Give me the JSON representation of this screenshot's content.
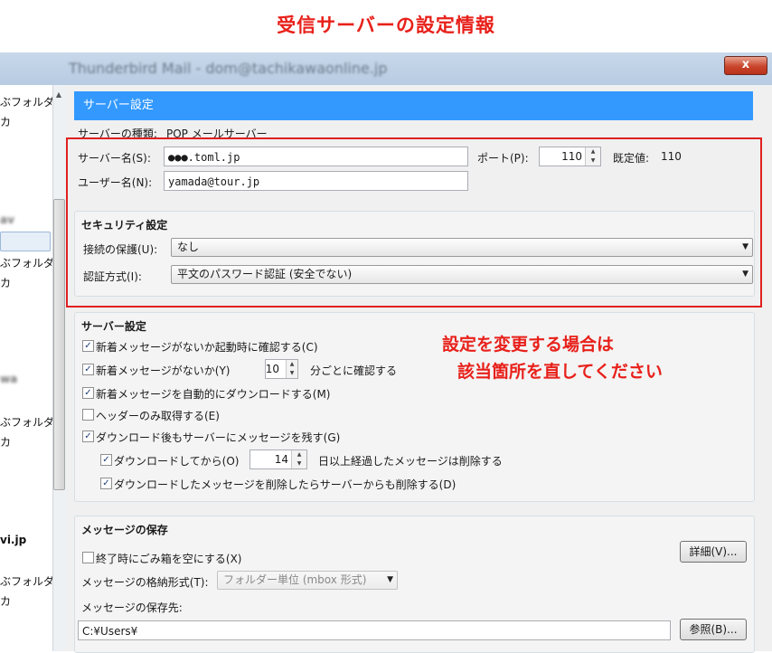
{
  "annotation": {
    "top_title": "受信サーバーの設定情報",
    "note_line1": "設定を変更する場合は",
    "note_line2": "該当箇所を直してください"
  },
  "window": {
    "title": "Thunderbird Mail - dom@tachikawaonline.jp",
    "close_label": "x"
  },
  "sidebar": {
    "items": [
      {
        "label": "ぶフォルダー"
      },
      {
        "label": "カ"
      },
      {
        "label": "ぶフォルダー"
      },
      {
        "label": "カ"
      },
      {
        "label": "ぶフォルダー"
      },
      {
        "label": "カ"
      },
      {
        "label": "vi.jp"
      },
      {
        "label": "ぶフォルダー"
      },
      {
        "label": "カ"
      }
    ]
  },
  "server_settings": {
    "banner": "サーバー設定",
    "server_type_label": "サーバーの種類:",
    "server_type_value": "POP メールサーバー",
    "server_name_label": "サーバー名(S):",
    "server_name_value": "●●●.toml.jp",
    "port_label": "ポート(P):",
    "port_value": "110",
    "default_label": "既定値:",
    "default_value": "110",
    "username_label": "ユーザー名(N):",
    "username_value": "yamada@tour.jp"
  },
  "security": {
    "title": "セキュリティ設定",
    "connection_label": "接続の保護(U):",
    "connection_value": "なし",
    "auth_label": "認証方式(I):",
    "auth_value": "平文のパスワード認証 (安全でない)"
  },
  "server_options": {
    "title": "サーバー設定",
    "check_on_startup": {
      "label": "新着メッセージがないか起動時に確認する(C)",
      "checked": true
    },
    "check_every": {
      "label": "新着メッセージがないか(Y)",
      "checked": true,
      "value": "10",
      "suffix": "分ごとに確認する"
    },
    "auto_download": {
      "label": "新着メッセージを自動的にダウンロードする(M)",
      "checked": true
    },
    "headers_only": {
      "label": "ヘッダーのみ取得する(E)",
      "checked": false
    },
    "leave_on_server": {
      "label": "ダウンロード後もサーバーにメッセージを残す(G)",
      "checked": true
    },
    "delete_after": {
      "label": "ダウンロードしてから(O)",
      "checked": true,
      "value": "14",
      "suffix": "日以上経過したメッセージは削除する"
    },
    "delete_from_server": {
      "label": "ダウンロードしたメッセージを削除したらサーバーからも削除する(D)",
      "checked": true
    }
  },
  "message_storage": {
    "title": "メッセージの保存",
    "empty_trash": {
      "label": "終了時にごみ箱を空にする(X)",
      "checked": false
    },
    "details_button": "詳細(V)...",
    "store_type_label": "メッセージの格納形式(T):",
    "store_type_value": "フォルダー単位 (mbox 形式)",
    "store_location_label": "メッセージの保存先:",
    "store_location_value": "C:¥Users¥",
    "browse_button": "参照(B)..."
  }
}
